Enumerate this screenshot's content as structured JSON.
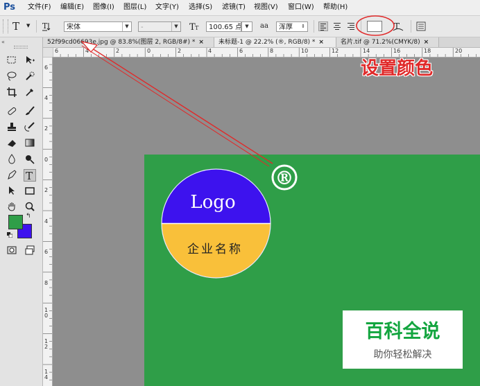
{
  "app": {
    "logo": "Ps"
  },
  "menu": [
    "文件(F)",
    "编辑(E)",
    "图像(I)",
    "图层(L)",
    "文字(Y)",
    "选择(S)",
    "滤镜(T)",
    "视图(V)",
    "窗口(W)",
    "帮助(H)"
  ],
  "options": {
    "tool_glyph": "T",
    "font_family": "宋体",
    "font_style": "-",
    "font_size": "100.65 点",
    "aa_glyph": "aa",
    "antialias": "浑厚",
    "text_color": "#ffffff"
  },
  "tabs": [
    {
      "label": "52f99cd06693e.jpg @ 83.8%(图层 2, RGB/8#) *",
      "close": "×"
    },
    {
      "label": "未标题-1 @ 22.2% (®, RGB/8) *",
      "close": "×"
    },
    {
      "label": "名片.tif @ 71.2%(CMYK/8)",
      "close": "×"
    }
  ],
  "ruler_h": [
    "6",
    "4",
    "2",
    "0",
    "2",
    "4",
    "6",
    "8",
    "10",
    "12",
    "14",
    "16",
    "18",
    "20"
  ],
  "ruler_v": [
    "6",
    "4",
    "2",
    "0",
    "2",
    "4",
    "6",
    "8",
    "1\n0",
    "1\n2",
    "1\n4"
  ],
  "canvas": {
    "logo_text": "Logo",
    "company_text": "企业名称",
    "registered_mark": "®",
    "colors": {
      "background": "#2f9e48",
      "top_half": "#3d12ee",
      "bottom_half": "#f9c03a",
      "outline": "#ffffff"
    }
  },
  "annotation": {
    "callout": "设置颜色",
    "color": "#e02a2a"
  },
  "watermark": {
    "main": "百科全说",
    "sub": "助你轻松解决"
  }
}
